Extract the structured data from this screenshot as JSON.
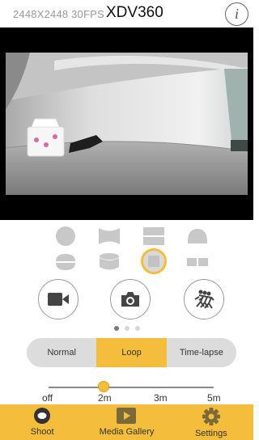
{
  "header": {
    "resolution_text": "2448X2448 30FPS",
    "camera_name": "XDV360",
    "info_icon": "i"
  },
  "colors": {
    "accent": "#f5bd3c",
    "preview_bg": "#000000",
    "segment_bg": "#dcdcdc"
  },
  "lens_modes": [
    {
      "name": "circle-lens-icon",
      "selected": false
    },
    {
      "name": "bowtie-lens-icon",
      "selected": false
    },
    {
      "name": "split-horizontal-lens-icon",
      "selected": false
    },
    {
      "name": "dome-lens-icon",
      "selected": false
    },
    {
      "name": "bowl-lens-icon",
      "selected": false
    },
    {
      "name": "cylinder-lens-icon",
      "selected": false
    },
    {
      "name": "square-lens-icon",
      "selected": true
    },
    {
      "name": "dual-rect-lens-icon",
      "selected": false
    }
  ],
  "controls": [
    {
      "name": "video-button",
      "icon": "video-camera-icon"
    },
    {
      "name": "photo-button",
      "icon": "camera-icon"
    },
    {
      "name": "burst-button",
      "icon": "burst-runner-icon"
    }
  ],
  "page_dots": {
    "count": 3,
    "active": 0
  },
  "modes": {
    "options": [
      "Normal",
      "Loop",
      "Time-lapse"
    ],
    "selected": "Loop"
  },
  "loop_duration": {
    "ticks": [
      "off",
      "2m",
      "3m",
      "5m"
    ],
    "selected": "2m"
  },
  "tabs": [
    {
      "label": "Shoot",
      "icon": "shoot-lens-icon",
      "active": true
    },
    {
      "label": "Media Gallery",
      "icon": "play-icon",
      "active": false
    },
    {
      "label": "Settings",
      "icon": "gear-icon",
      "active": false
    }
  ]
}
